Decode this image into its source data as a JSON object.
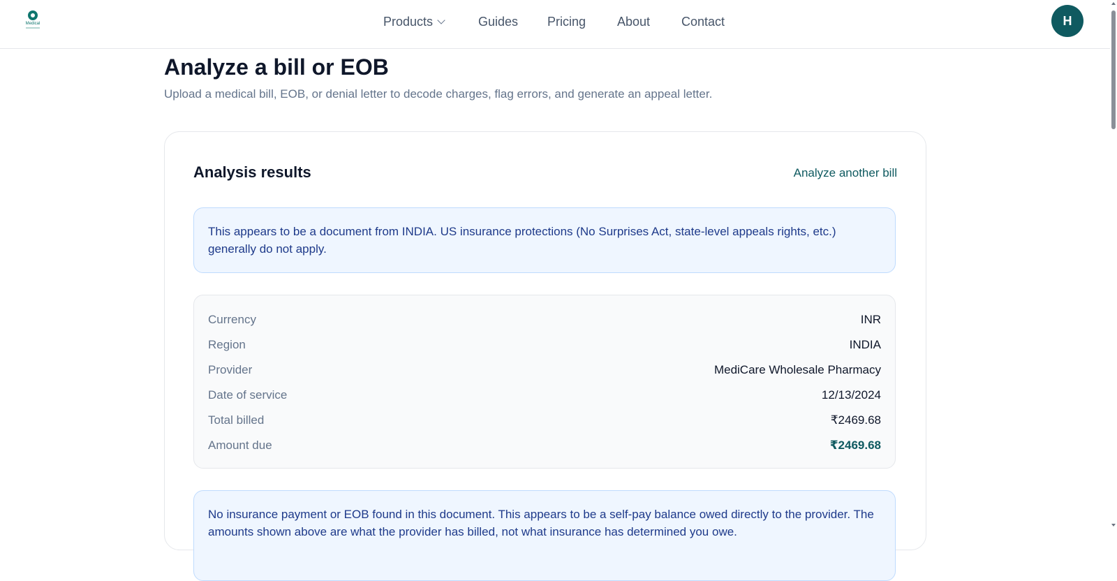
{
  "header": {
    "logo_text": "Medical",
    "nav": [
      {
        "label": "Products",
        "has_dropdown": true
      },
      {
        "label": "Guides"
      },
      {
        "label": "Pricing"
      },
      {
        "label": "About"
      },
      {
        "label": "Contact"
      }
    ],
    "avatar_initial": "H"
  },
  "page": {
    "title": "Analyze a bill or EOB",
    "subtitle": "Upload a medical bill, EOB, or denial letter to decode charges, flag errors, and generate an appeal letter."
  },
  "results": {
    "title": "Analysis results",
    "action_link": "Analyze another bill",
    "region_notice": "This appears to be a document from INDIA. US insurance protections (No Surprises Act, state-level appeals rights, etc.) generally do not apply.",
    "details": [
      {
        "label": "Currency",
        "value": "INR"
      },
      {
        "label": "Region",
        "value": "INDIA"
      },
      {
        "label": "Provider",
        "value": "MediCare Wholesale Pharmacy"
      },
      {
        "label": "Date of service",
        "value": "12/13/2024"
      },
      {
        "label": "Total billed",
        "value": "₹2469.68"
      },
      {
        "label": "Amount due",
        "value": "₹2469.68"
      }
    ],
    "selfpay_notice": "No insurance payment or EOB found in this document. This appears to be a self-pay balance owed directly to the provider. The amounts shown above are what the provider has billed, not what insurance has determined you owe."
  },
  "colors": {
    "brand": "#0f5a60",
    "notice_bg": "#eff6ff",
    "notice_text": "#1e3a8a"
  }
}
